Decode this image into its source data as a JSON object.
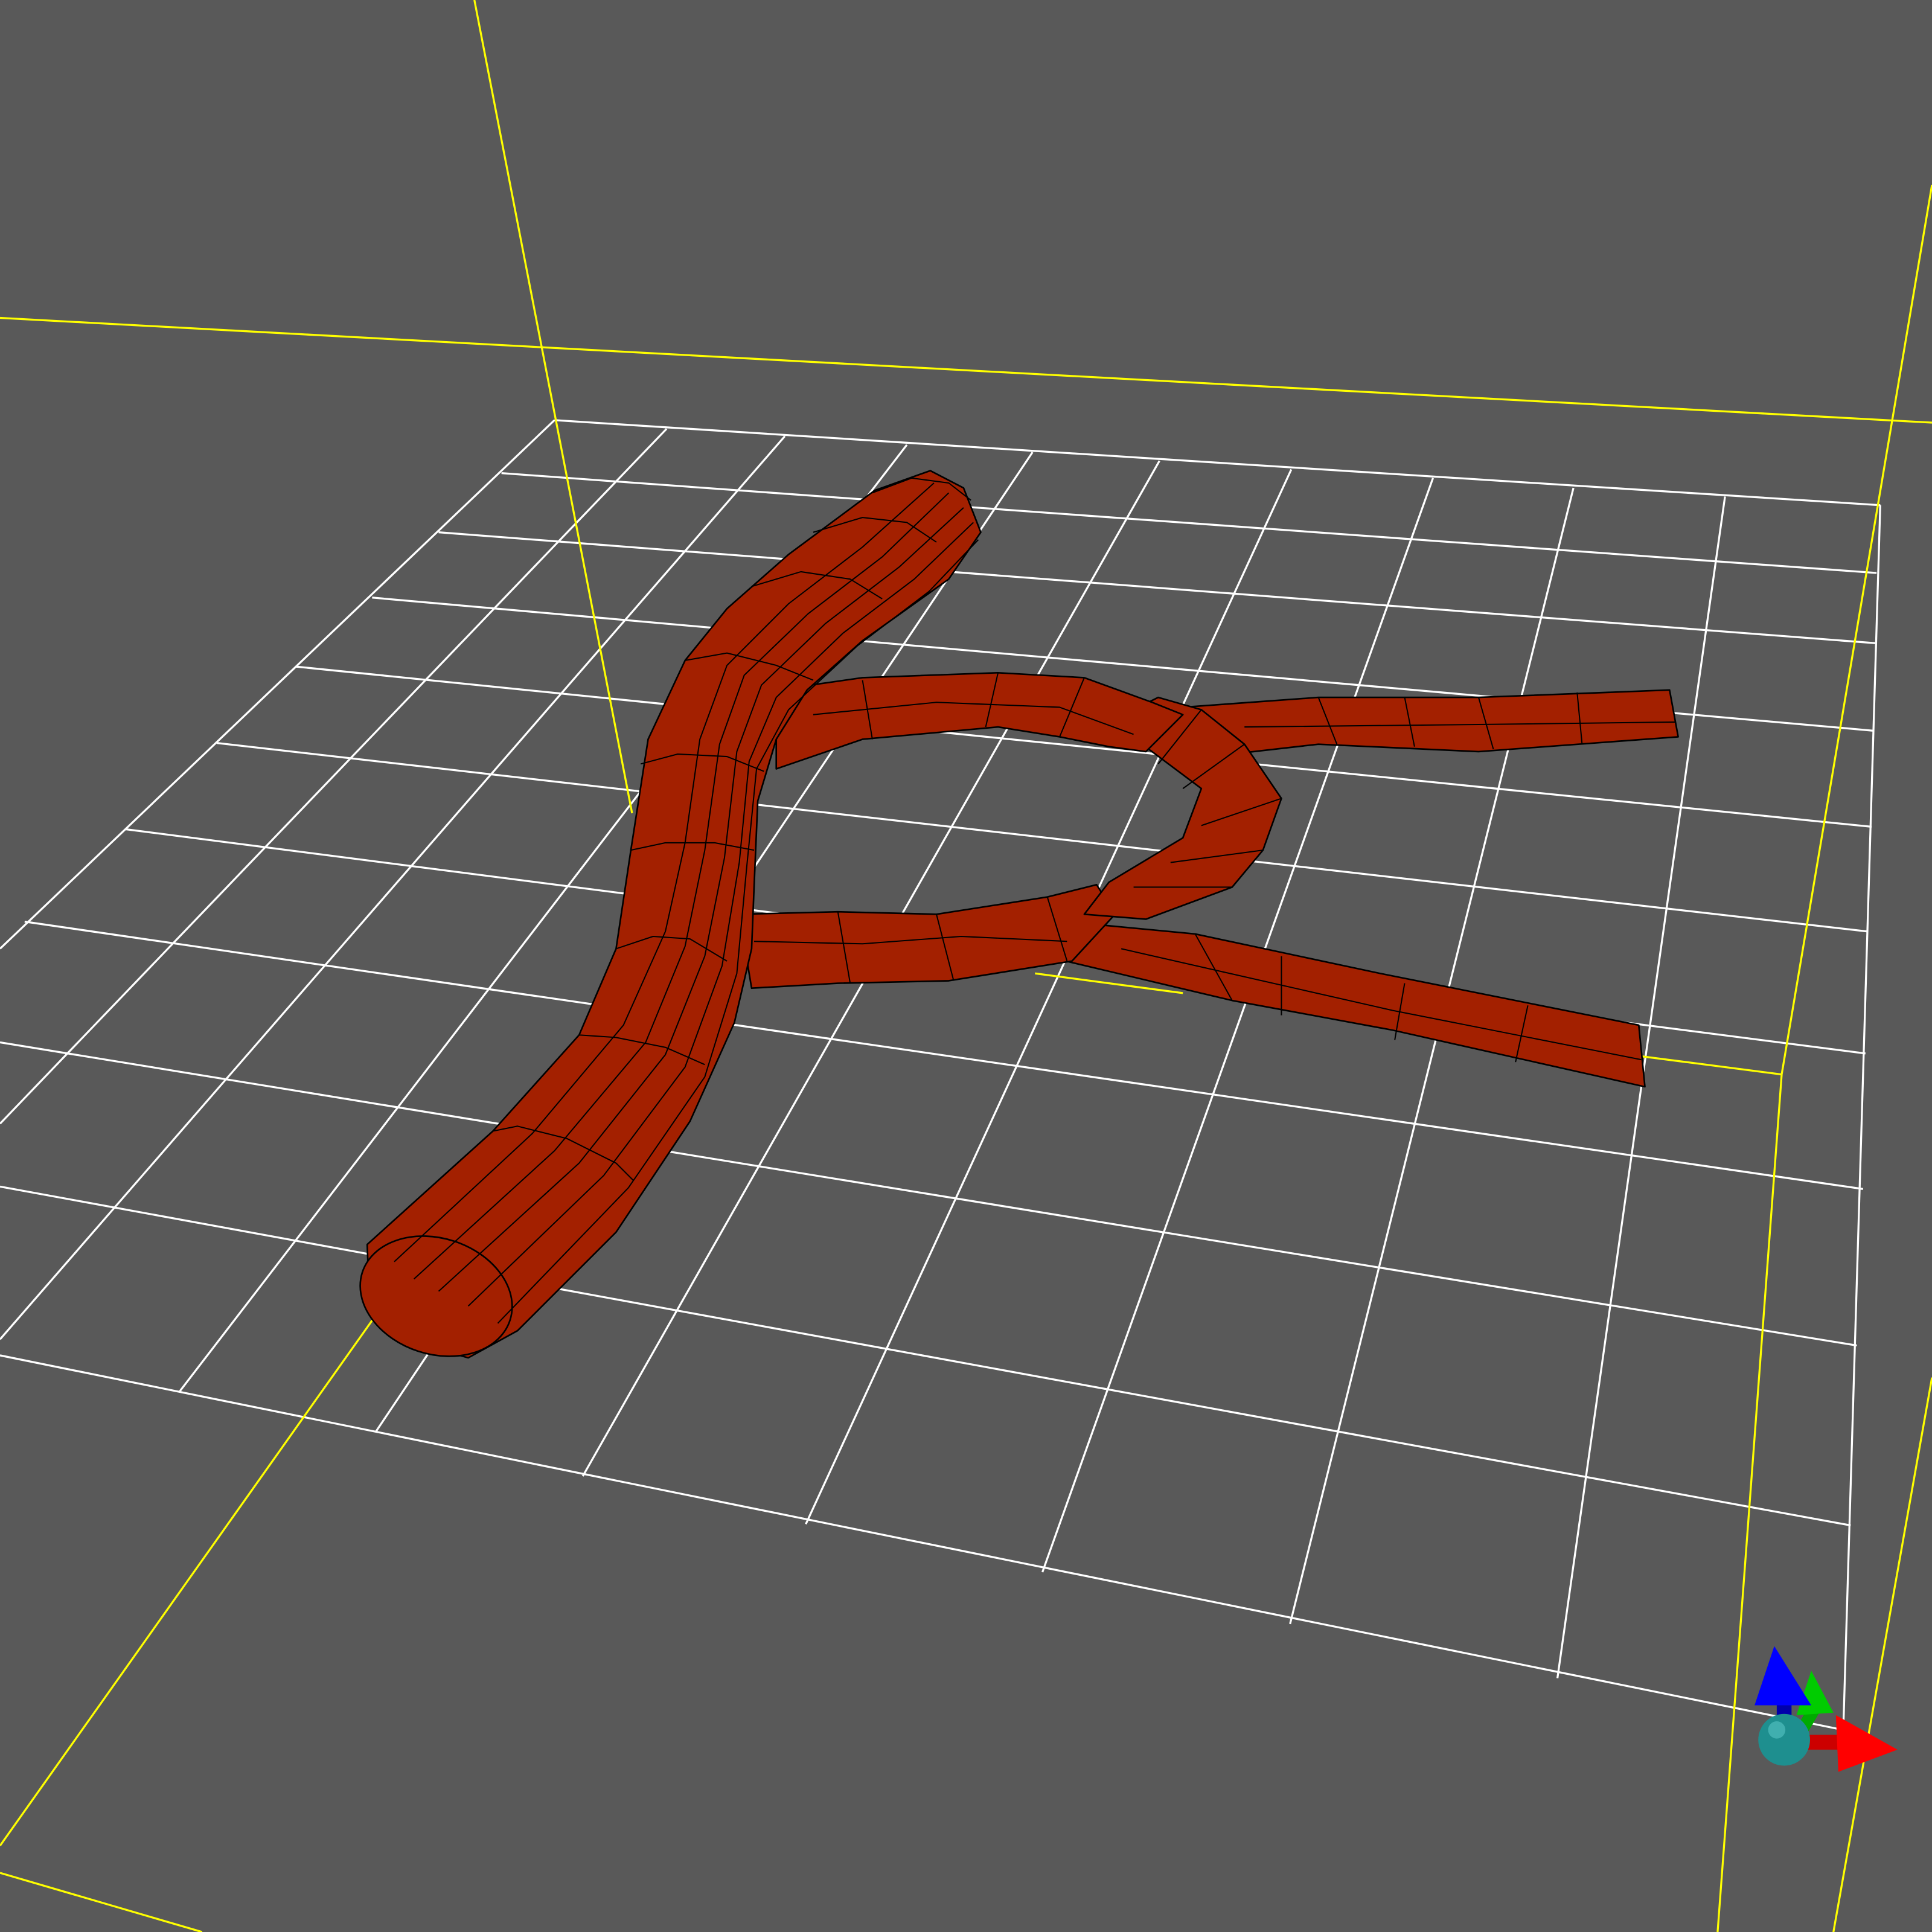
{
  "viewport": {
    "background": "#595959",
    "bounding_box_color": "#ffff00",
    "grid_color": "#ffffff"
  },
  "mesh": {
    "fill": "#a32000",
    "edge_color": "#000000"
  },
  "axes_gizmo": {
    "x_axis_color": "#ff0000",
    "y_axis_color": "#00cc00",
    "z_axis_color": "#0000ff",
    "origin_color": "#1e8f8f",
    "icons": [
      "x-axis-arrow-icon",
      "y-axis-arrow-icon",
      "z-axis-arrow-icon",
      "origin-sphere-icon"
    ]
  }
}
